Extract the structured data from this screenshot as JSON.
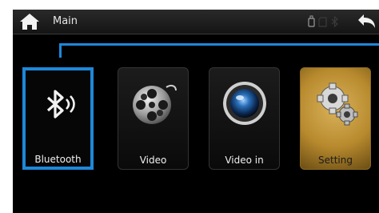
{
  "header": {
    "title": "Main",
    "home_icon": "home-icon",
    "back_icon": "back-arrow-icon"
  },
  "status_icons": [
    "usb-icon",
    "sd-card-icon",
    "bluetooth-status-icon"
  ],
  "tiles": [
    {
      "label": "Bluetooth",
      "icon": "bluetooth-icon",
      "selected": true
    },
    {
      "label": "Video",
      "icon": "film-reel-icon",
      "selected": false
    },
    {
      "label": "Video in",
      "icon": "camera-lens-icon",
      "selected": false
    },
    {
      "label": "Setting",
      "icon": "gears-icon",
      "selected": false
    }
  ],
  "colors": {
    "accent": "#1e88d8",
    "setting_tile": "#c49a3e",
    "background": "#000000"
  }
}
